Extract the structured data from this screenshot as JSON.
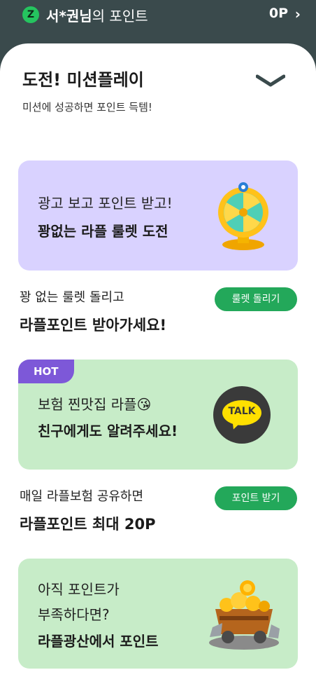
{
  "header": {
    "logo_letter": "Z",
    "user_name": "서*권님",
    "user_suffix": "의 포인트",
    "points": "0P",
    "chevron": "›"
  },
  "section": {
    "title": "도전! 미션플레이",
    "subtitle": "미션에 성공하면 포인트 득템!"
  },
  "cards": {
    "roulette": {
      "line1": "광고 보고 포인트 받고!",
      "line2": "꽝없는 라플 룰렛 도전"
    },
    "share": {
      "badge": "HOT",
      "line1": "보험 찐맛집 라플😘",
      "line2": "친구에게도 알려주세요!",
      "talk_label": "TALK"
    },
    "mine": {
      "line1": "아직 포인트가",
      "line2": "부족하다면?",
      "line3": "라플광산에서 포인트"
    }
  },
  "rows": {
    "roulette": {
      "line1": "꽝 없는 룰렛 돌리고",
      "line2": "라플포인트 받아가세요!",
      "button": "룰렛 돌리기"
    },
    "share": {
      "line1": "매일 라플보험 공유하면",
      "line2": "라플포인트 최대 20P",
      "button": "포인트 받기"
    }
  },
  "colors": {
    "accent_green": "#23a85a",
    "purple_card": "#d9d2ff",
    "green_card": "#c7ecc8",
    "hot_badge": "#7d58d8"
  }
}
